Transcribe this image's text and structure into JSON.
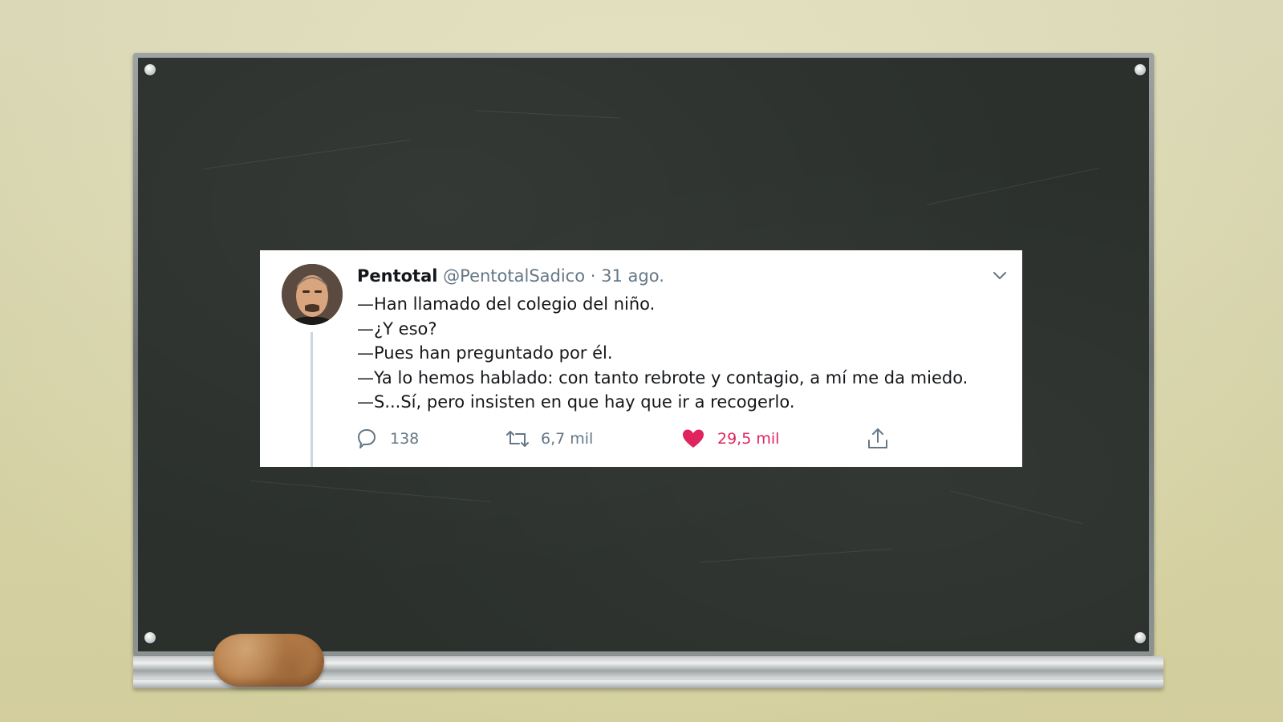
{
  "tweet": {
    "author": {
      "name": "Pentotal",
      "handle": "@PentotalSadico",
      "separator": "·",
      "date": "31 ago."
    },
    "lines": [
      "—Han llamado del colegio del niño.",
      "—¿Y eso?",
      "—Pues han preguntado por él.",
      "—Ya lo hemos hablado: con tanto rebrote y contagio, a mí me da miedo.",
      "—S...Sí, pero insisten en que hay que ir a recogerlo."
    ],
    "stats": {
      "replies": "138",
      "retweets": "6,7 mil",
      "likes": "29,5 mil"
    },
    "icons": {
      "reply": "reply-icon",
      "retweet": "retweet-icon",
      "like": "heart-icon",
      "share": "share-icon",
      "menu": "chevron-down-icon"
    },
    "colors": {
      "text": "#14171a",
      "secondary": "#657786",
      "like": "#e0245e",
      "thread": "#ccd6dd"
    }
  },
  "scene": {
    "background": "chalkboard",
    "board_color": "#2b302c",
    "wall_color": "#e4e0b6"
  }
}
